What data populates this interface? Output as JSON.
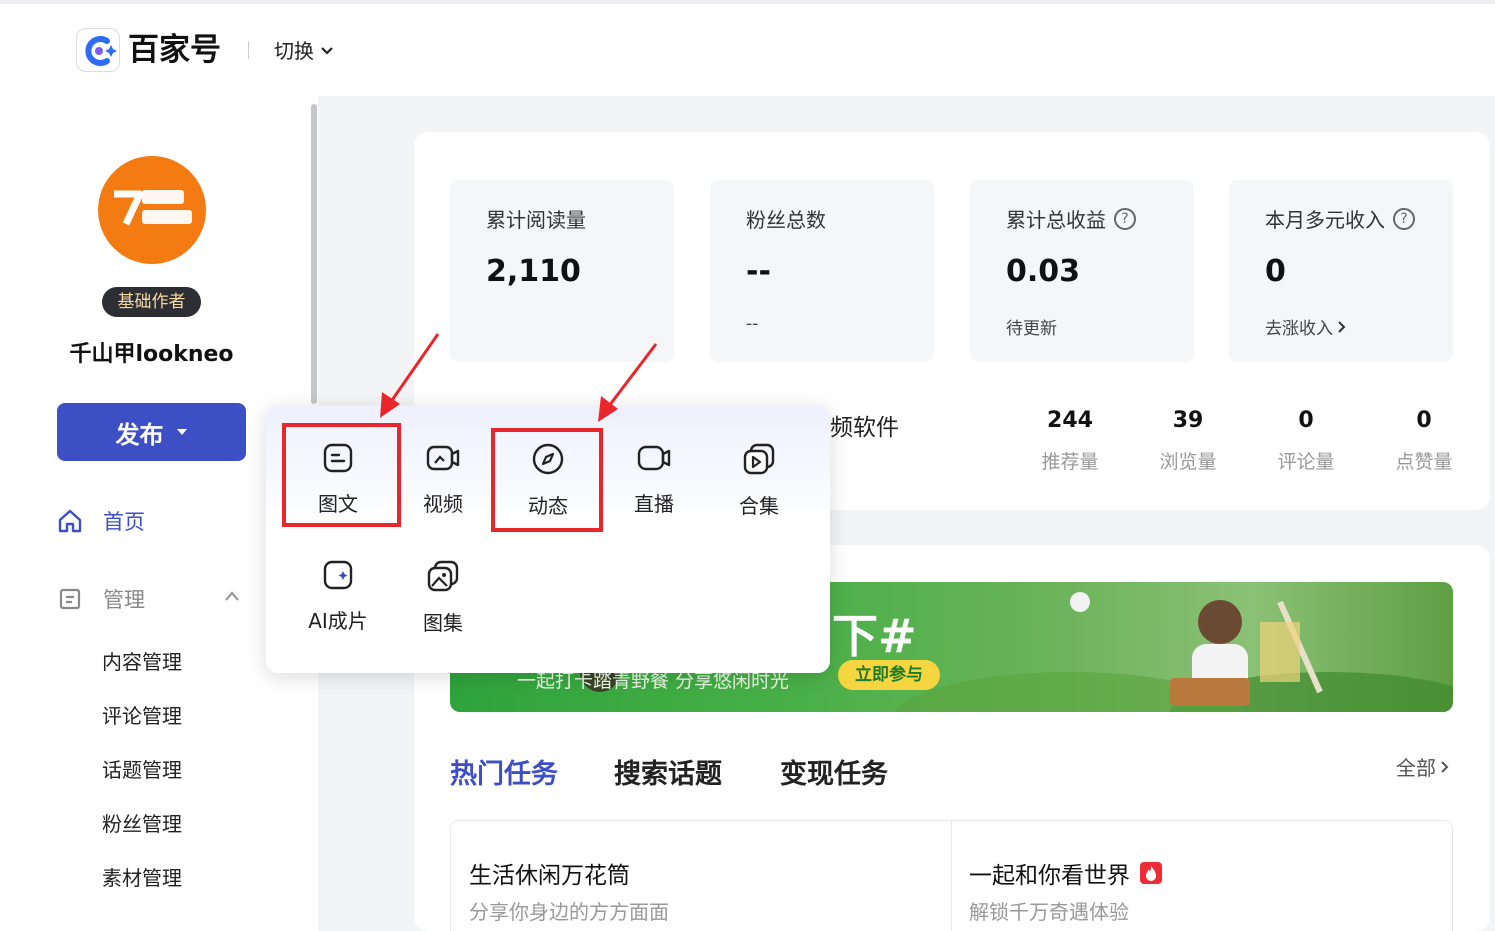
{
  "header": {
    "logo_text": "百家号",
    "switch_label": "切换"
  },
  "sidebar": {
    "badge": "基础作者",
    "username": "千山甲lookneo",
    "publish_label": "发布",
    "home_label": "首页",
    "manage_label": "管理",
    "sub_items": [
      "内容管理",
      "评论管理",
      "话题管理",
      "粉丝管理",
      "素材管理"
    ]
  },
  "stats": [
    {
      "label": "累计阅读量",
      "value": "2,110",
      "sub": ""
    },
    {
      "label": "粉丝总数",
      "value": "--",
      "sub": "--"
    },
    {
      "label": "累计总收益",
      "value": "0.03",
      "sub": "待更新"
    },
    {
      "label": "本月多元收入",
      "value": "0",
      "sub": "去涨收入"
    }
  ],
  "content_row": {
    "title_partial": "频软件",
    "metrics": [
      {
        "value": "244",
        "label": "推荐量"
      },
      {
        "value": "39",
        "label": "浏览量"
      },
      {
        "value": "0",
        "label": "评论量"
      },
      {
        "value": "0",
        "label": "点赞量"
      }
    ]
  },
  "banner": {
    "title": "下#",
    "subtitle": "一起打卡踏青野餐 分享悠闲时光",
    "button": "立即参与"
  },
  "tabs": [
    "热门任务",
    "搜索话题",
    "变现任务"
  ],
  "view_all": "全部",
  "topics": [
    {
      "title": "生活休闲万花筒",
      "desc": "分享你身边的方方面面"
    },
    {
      "title": "一起和你看世界",
      "desc": "解锁千万奇遇体验"
    }
  ],
  "publish_menu": {
    "items": [
      "图文",
      "视频",
      "动态",
      "直播",
      "合集",
      "AI成片",
      "图集"
    ]
  },
  "colors": {
    "accent": "#3d4fc5",
    "annotation": "#e8262b"
  }
}
